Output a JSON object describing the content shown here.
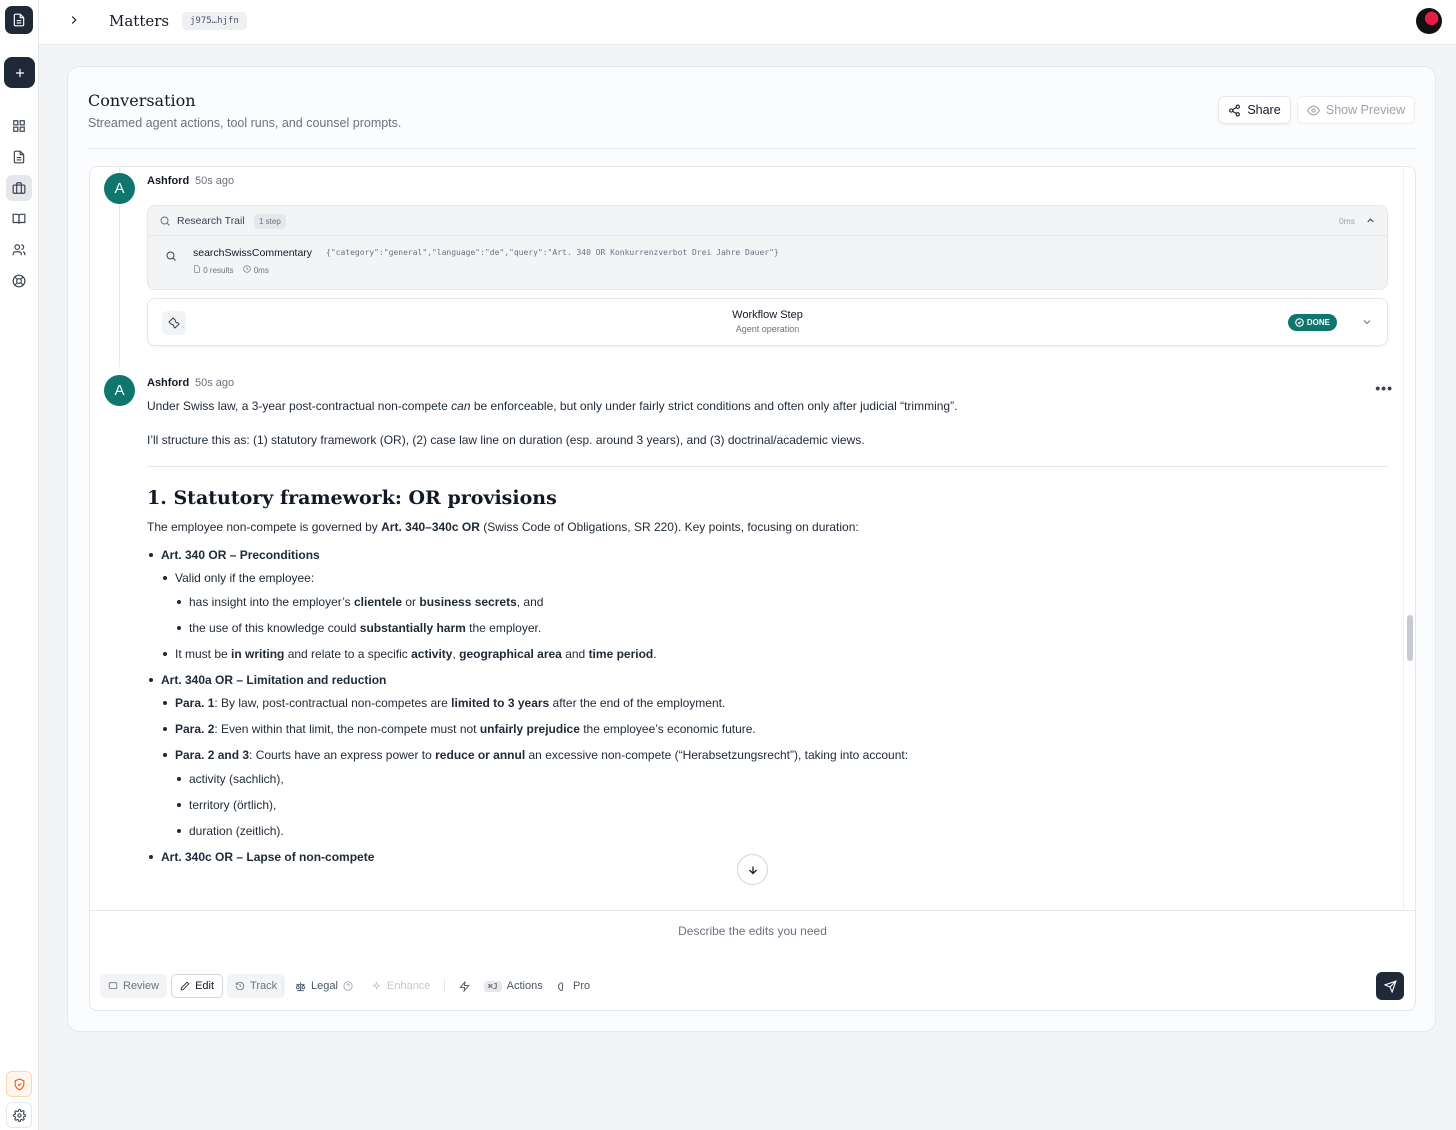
{
  "header": {
    "breadcrumb_title": "Matters",
    "matter_id": "j975…hjfn"
  },
  "panel": {
    "title": "Conversation",
    "subtitle": "Streamed agent actions, tool runs, and counsel prompts.",
    "share_label": "Share",
    "preview_label": "Show Preview"
  },
  "messages": [
    {
      "avatar_letter": "A",
      "author": "Ashford",
      "time": "50s ago",
      "research_trail": {
        "label": "Research Trail",
        "steps_badge": "1 step",
        "duration": "0ms",
        "tool": {
          "name": "searchSwissCommentary",
          "args": "{\"category\":\"general\",\"language\":\"de\",\"query\":\"Art. 340 OR Konkurrenzverbot Drei Jahre Dauer\"}",
          "results": "0 results",
          "duration": "0ms"
        }
      },
      "workflow_step": {
        "title": "Workflow Step",
        "subtitle": "Agent operation",
        "status": "DONE"
      }
    },
    {
      "avatar_letter": "A",
      "author": "Ashford",
      "time": "50s ago",
      "more_label": "•••",
      "intro_a1": "Under Swiss law, a 3-year post-contractual non-compete ",
      "intro_a2": "can",
      "intro_a3": " be enforceable, but only under fairly strict conditions and often only after judicial “trimming”.",
      "intro_b": "I’ll structure this as: (1) statutory framework (OR), (2) case law line on duration (esp. around 3 years), and (3) doctrinal/academic views.",
      "heading": "1. Statutory framework: OR provisions",
      "lead_1": "The employee non-compete is governed by ",
      "lead_bold": "Art. 340–340c OR",
      "lead_2": " (Swiss Code of Obligations, SR 220). Key points, focusing on duration:",
      "s1_title": "Art. 340 OR – Preconditions",
      "s1_valid": "Valid only if the employee:",
      "s1_c1_a": "has insight into the employer’s ",
      "s1_c1_b": "clientele",
      "s1_c1_c": " or ",
      "s1_c1_d": "business secrets",
      "s1_c1_e": ", and",
      "s1_c2_a": "the use of this knowledge could ",
      "s1_c2_b": "substantially harm",
      "s1_c2_c": " the employer.",
      "s1_w_a": "It must be ",
      "s1_w_b": "in writing",
      "s1_w_c": " and relate to a specific ",
      "s1_w_d": "activity",
      "s1_w_e": ", ",
      "s1_w_f": "geographical area",
      "s1_w_g": " and ",
      "s1_w_h": "time period",
      "s1_w_i": ".",
      "s2_title": "Art. 340a OR – Limitation and reduction",
      "p1_label": "Para. 1",
      "p1_a": ": By law, post-contractual non-competes are ",
      "p1_b": "limited to 3 years",
      "p1_c": " after the end of the employment.",
      "p2_label": "Para. 2",
      "p2_a": ": Even within that limit, the non-compete must not ",
      "p2_b": "unfairly prejudice",
      "p2_c": " the employee’s economic future.",
      "p3_label": "Para. 2 and 3",
      "p3_a": ": Courts have an express power to ",
      "p3_b": "reduce or annul",
      "p3_c": " an excessive non-compete (“Herabsetzungsrecht”), taking into account:",
      "factors": [
        "activity (sachlich),",
        "territory (örtlich),",
        "duration (zeitlich)."
      ],
      "s3_title": "Art. 340c OR – Lapse of non-compete"
    }
  ],
  "composer": {
    "placeholder": "Describe the edits you need",
    "modes": [
      "Review",
      "Edit",
      "Track"
    ],
    "active_mode": "Edit",
    "legal_label": "Legal",
    "enhance_label": "Enhance",
    "shortcut": "⌘J",
    "actions_label": "Actions",
    "pro_label": "Pro"
  },
  "colors": {
    "accent_teal": "#0f766e",
    "dark": "#1f2937"
  },
  "icons": {
    "sidebar": [
      "document-icon",
      "plus-icon",
      "grid-icon",
      "file-text-icon",
      "briefcase-icon",
      "book-icon",
      "users-icon",
      "lifebuoy-icon",
      "shield-icon",
      "gear-icon"
    ]
  }
}
